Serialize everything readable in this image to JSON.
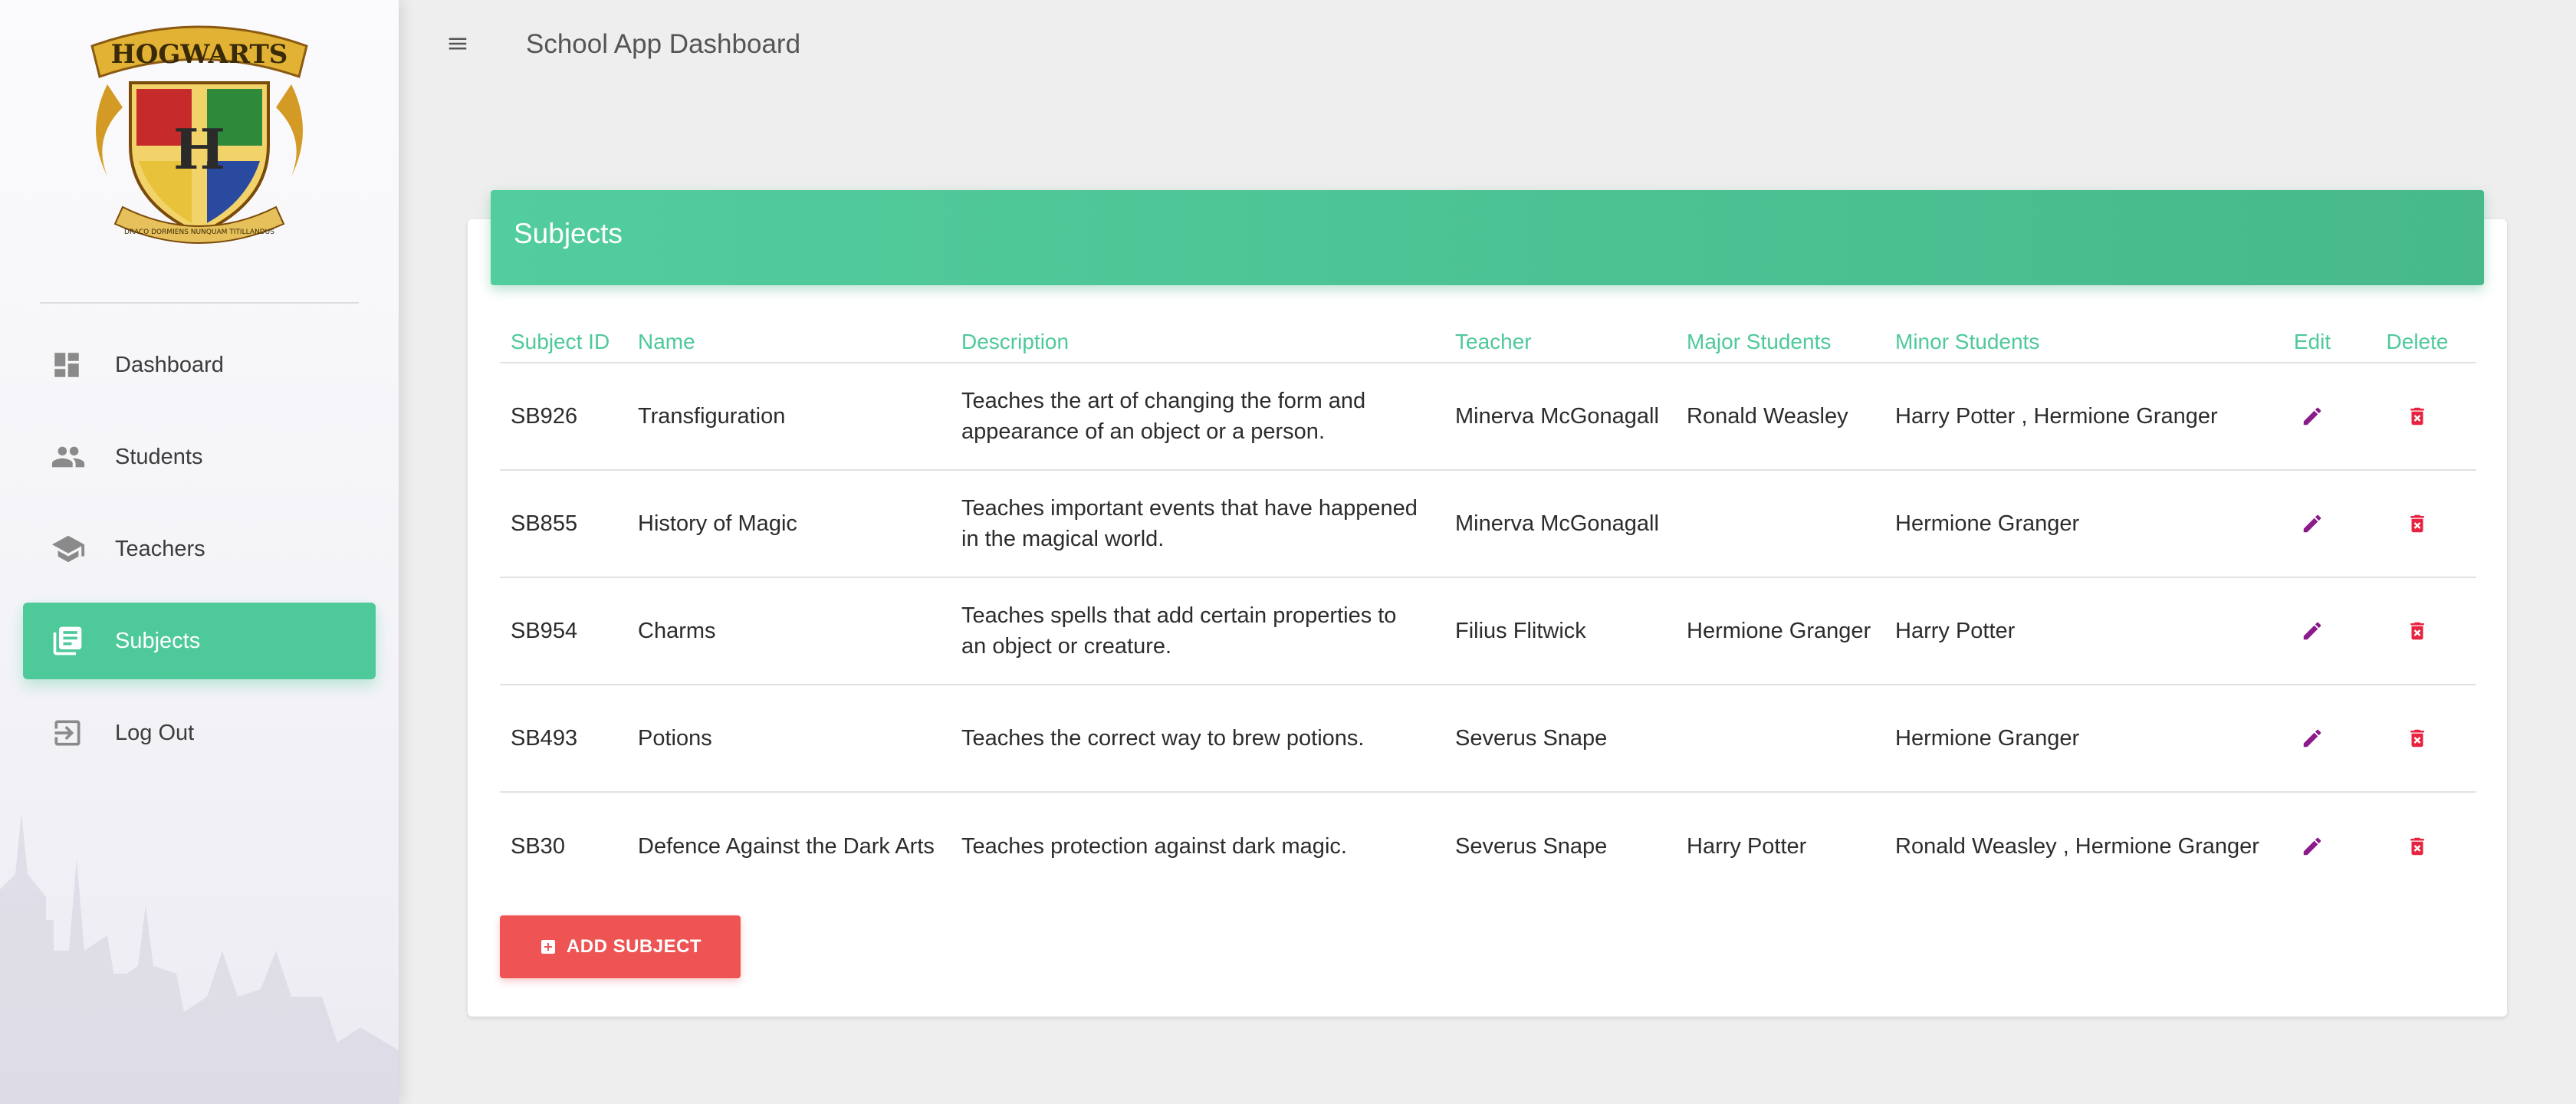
{
  "app": {
    "title": "School App Dashboard"
  },
  "logo": {
    "text": "HOGWARTS",
    "motto": "DRACO DORMIENS NUNQUAM TITILLANDUS",
    "letter": "H"
  },
  "sidebar": {
    "items": [
      {
        "label": "Dashboard",
        "icon": "dashboard-icon",
        "active": false
      },
      {
        "label": "Students",
        "icon": "people-icon",
        "active": false
      },
      {
        "label": "Teachers",
        "icon": "school-icon",
        "active": false
      },
      {
        "label": "Subjects",
        "icon": "library-books-icon",
        "active": true
      },
      {
        "label": "Log Out",
        "icon": "logout-icon",
        "active": false
      }
    ]
  },
  "card": {
    "title": "Subjects"
  },
  "table": {
    "headers": {
      "id": "Subject ID",
      "name": "Name",
      "description": "Description",
      "teacher": "Teacher",
      "major": "Major Students",
      "minor": "Minor Students",
      "edit": "Edit",
      "delete": "Delete"
    },
    "rows": [
      {
        "id": "SB926",
        "name": "Transfiguration",
        "description": "Teaches the art of changing the form and appearance of an object or a person.",
        "teacher": "Minerva McGonagall",
        "major": "Ronald Weasley",
        "minor": "Harry Potter , Hermione Granger"
      },
      {
        "id": "SB855",
        "name": "History of Magic",
        "description": "Teaches important events that have happened in the magical world.",
        "teacher": "Minerva McGonagall",
        "major": "",
        "minor": "Hermione Granger"
      },
      {
        "id": "SB954",
        "name": "Charms",
        "description": "Teaches spells that add certain properties to an object or creature.",
        "teacher": "Filius Flitwick",
        "major": "Hermione Granger",
        "minor": "Harry Potter"
      },
      {
        "id": "SB493",
        "name": "Potions",
        "description": "Teaches the correct way to brew potions.",
        "teacher": "Severus Snape",
        "major": "",
        "minor": "Hermione Granger"
      },
      {
        "id": "SB30",
        "name": "Defence Against the Dark Arts",
        "description": "Teaches protection against dark magic.",
        "teacher": "Severus Snape",
        "major": "Harry Potter",
        "minor": "Ronald Weasley , Hermione Granger"
      }
    ]
  },
  "actions": {
    "add_label": "ADD SUBJECT"
  },
  "colors": {
    "accent": "#4ec99a",
    "edit_icon": "#8b1a8b",
    "delete_icon": "#e8233f",
    "add_button": "#ef5454"
  }
}
